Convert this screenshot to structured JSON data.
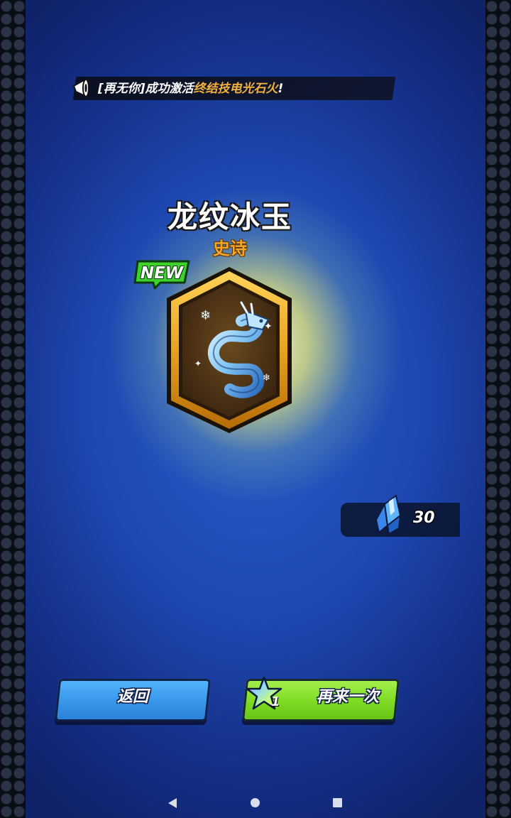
{
  "announcement": {
    "prefix": "[再无你]成功激活",
    "highlight": "终结技电光石火",
    "suffix": "!"
  },
  "item": {
    "name": "龙纹冰玉",
    "rarity": "史诗",
    "badge": "NEW",
    "icon": "ice-dragon-jade-icon"
  },
  "currency": {
    "icon": "blue-crystal-icon",
    "amount": "30"
  },
  "buttons": {
    "back_label": "返回",
    "again_label": "再来一次",
    "again_cost_icon": "rainbow-star-icon",
    "again_cost": "1"
  },
  "colors": {
    "rarity_epic": "#f6a52a",
    "highlight": "#f3b23b",
    "badge_green": "#3fd12c",
    "back_button": "#3796ea",
    "again_button": "#7dda22"
  }
}
